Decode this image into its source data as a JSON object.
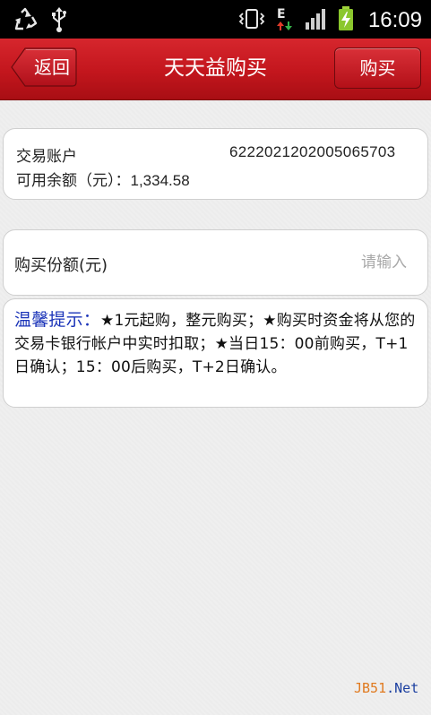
{
  "status_bar": {
    "time": "16:09",
    "network_type": "E"
  },
  "header": {
    "back_label": "返回",
    "title": "天天益购买",
    "buy_label": "购买"
  },
  "account": {
    "label": "交易账户",
    "number": "6222021202005065703",
    "balance_label": "可用余额（元）：",
    "balance_value": "1,334.58"
  },
  "purchase": {
    "label": "购买份额(元)",
    "placeholder": "请输入"
  },
  "tip": {
    "label": "温馨提示：",
    "text": "★1元起购，整元购买；★购买时资金将从您的交易卡银行帐户中实时扣取；★当日15：00前购买，T+1日确认；15：00后购买，T+2日确认。"
  },
  "watermark": {
    "part1": "JB51",
    "part2": ".Net"
  },
  "colors": {
    "header_red": "#c3161d",
    "tip_label_blue": "#1a33b8",
    "watermark_orange": "#e07a1f",
    "watermark_blue": "#1b3fa0"
  }
}
